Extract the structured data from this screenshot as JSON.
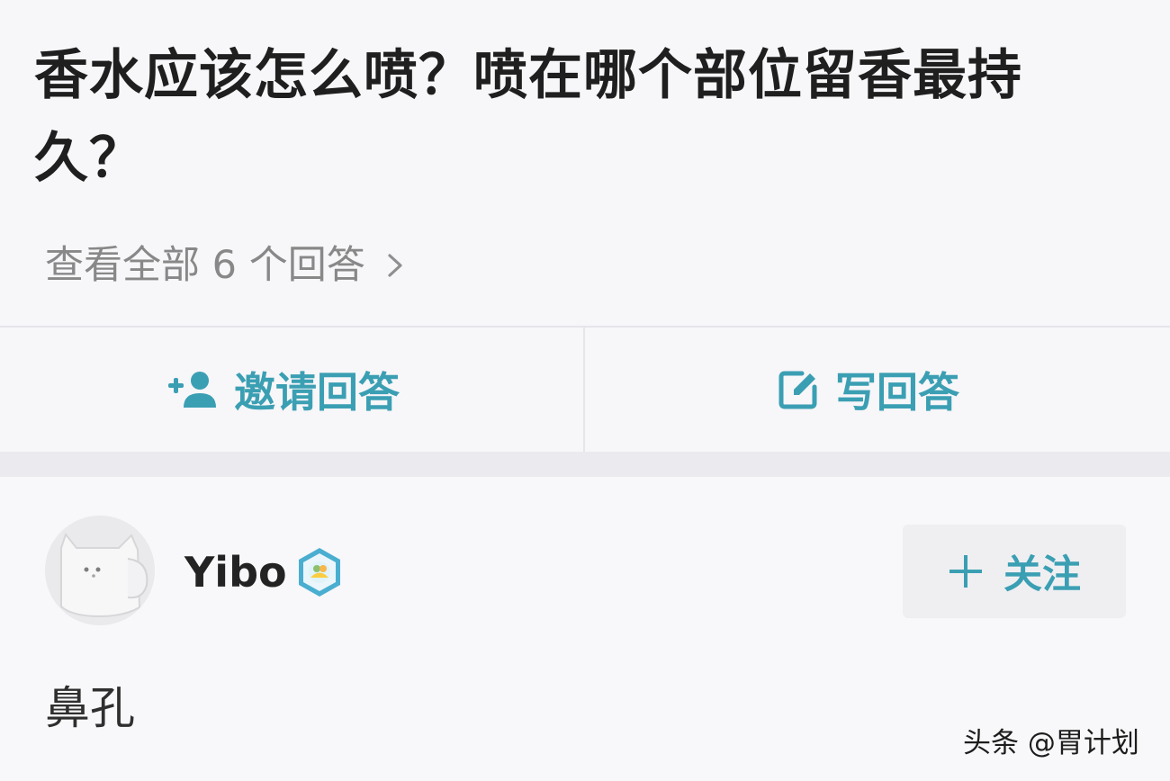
{
  "question": {
    "title": "香水应该怎么喷？喷在哪个部位留香最持久？",
    "view_all_label": "查看全部 6 个回答"
  },
  "actions": {
    "invite_label": "邀请回答",
    "write_label": "写回答"
  },
  "answer": {
    "username": "Yibo",
    "follow_label": "关注",
    "text": "鼻孔"
  },
  "watermark": "头条 @胃计划",
  "colors": {
    "accent": "#3b9fb3",
    "background": "#f7f6f9",
    "title_text": "#1f1f1f",
    "muted_text": "#888888"
  },
  "icons": {
    "view_all": "chevron-right-icon",
    "invite": "add-user-icon",
    "write": "edit-icon",
    "verified": "verified-badge-icon",
    "follow": "plus-icon"
  }
}
